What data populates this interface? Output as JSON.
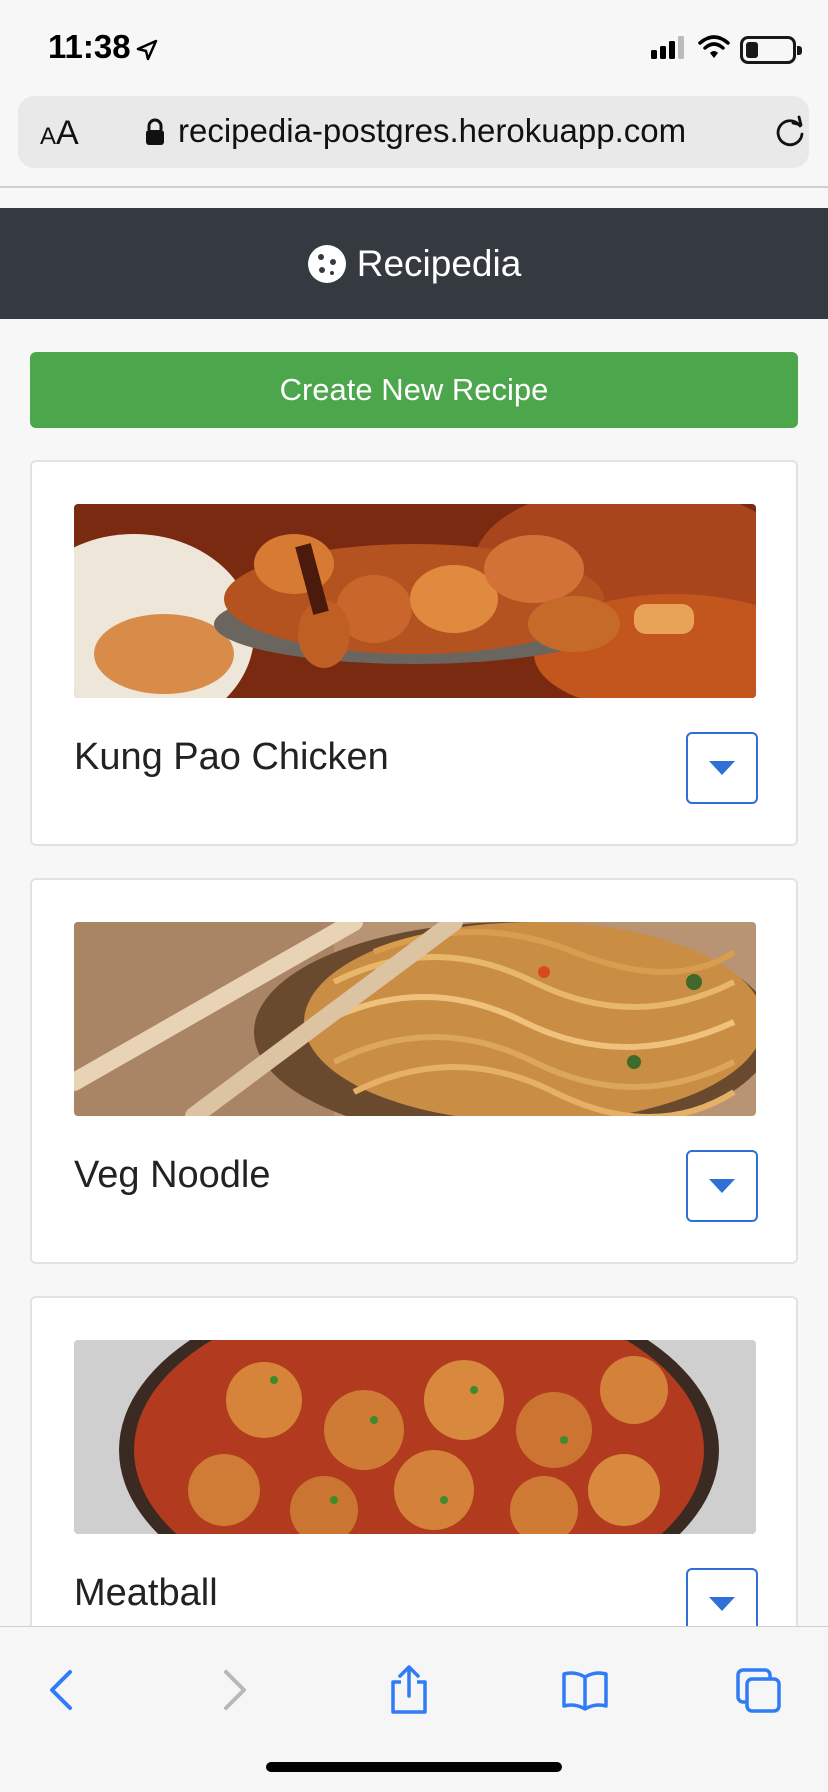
{
  "status": {
    "time": "11:38"
  },
  "address_bar": {
    "text_size_label": "AA",
    "url": "recipedia-postgres.herokuapp.com"
  },
  "navbar": {
    "brand": "Recipedia"
  },
  "actions": {
    "create_label": "Create New Recipe"
  },
  "recipes": [
    {
      "title": "Kung Pao Chicken",
      "image": "kung-pao-chicken-photo"
    },
    {
      "title": "Veg Noodle",
      "image": "veg-noodle-photo"
    },
    {
      "title": "Meatball",
      "image": "meatball-photo"
    }
  ],
  "colors": {
    "navbar": "#343a40",
    "create_button": "#4ca64c",
    "accent": "#2f6fd6",
    "ios_blue": "#2f7cf6"
  },
  "toolbar": {
    "icons": [
      "back-icon",
      "forward-icon",
      "share-icon",
      "bookmarks-icon",
      "tabs-icon"
    ]
  }
}
